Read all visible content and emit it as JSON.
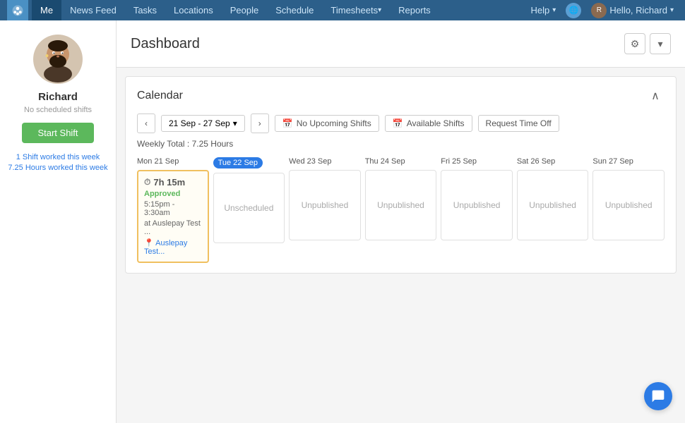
{
  "nav": {
    "logo_label": "Deputy",
    "items": [
      {
        "label": "Me",
        "active": true,
        "has_arrow": false
      },
      {
        "label": "News Feed",
        "active": false,
        "has_arrow": false
      },
      {
        "label": "Tasks",
        "active": false,
        "has_arrow": false
      },
      {
        "label": "Locations",
        "active": false,
        "has_arrow": false
      },
      {
        "label": "People",
        "active": false,
        "has_arrow": false
      },
      {
        "label": "Schedule",
        "active": false,
        "has_arrow": false
      },
      {
        "label": "Timesheets",
        "active": false,
        "has_arrow": true
      },
      {
        "label": "Reports",
        "active": false,
        "has_arrow": false
      }
    ],
    "right": {
      "help_label": "Help",
      "hello_label": "Hello, Richard"
    }
  },
  "sidebar": {
    "user_name": "Richard",
    "status": "No scheduled shifts",
    "start_shift_label": "Start Shift",
    "stats": [
      {
        "label": "1 Shift worked this week"
      },
      {
        "label": "7.25 Hours worked this week"
      }
    ]
  },
  "dashboard": {
    "title": "Dashboard",
    "calendar": {
      "title": "Calendar",
      "date_range": "21 Sep - 27 Sep",
      "weekly_total": "Weekly Total : 7.25 Hours",
      "buttons": {
        "no_upcoming": "No Upcoming Shifts",
        "available": "Available Shifts",
        "request_off": "Request Time Off"
      },
      "days": [
        {
          "header": "Mon 21 Sep",
          "today": false,
          "shift": {
            "has_shift": true,
            "duration": "7h 15m",
            "status": "Approved",
            "time": "5:15pm - 3:30am",
            "at": "at Auslepay Test ...",
            "location": "Auslepay Test..."
          }
        },
        {
          "header": "Tue 22 Sep",
          "today": true,
          "shift": {
            "has_shift": false,
            "label": "Unscheduled"
          }
        },
        {
          "header": "Wed 23 Sep",
          "today": false,
          "shift": {
            "has_shift": false,
            "label": "Unpublished"
          }
        },
        {
          "header": "Thu 24 Sep",
          "today": false,
          "shift": {
            "has_shift": false,
            "label": "Unpublished"
          }
        },
        {
          "header": "Fri 25 Sep",
          "today": false,
          "shift": {
            "has_shift": false,
            "label": "Unpublished"
          }
        },
        {
          "header": "Sat 26 Sep",
          "today": false,
          "shift": {
            "has_shift": false,
            "label": "Unpublished"
          }
        },
        {
          "header": "Sun 27 Sep",
          "today": false,
          "shift": {
            "has_shift": false,
            "label": "Unpublished"
          }
        }
      ]
    }
  }
}
